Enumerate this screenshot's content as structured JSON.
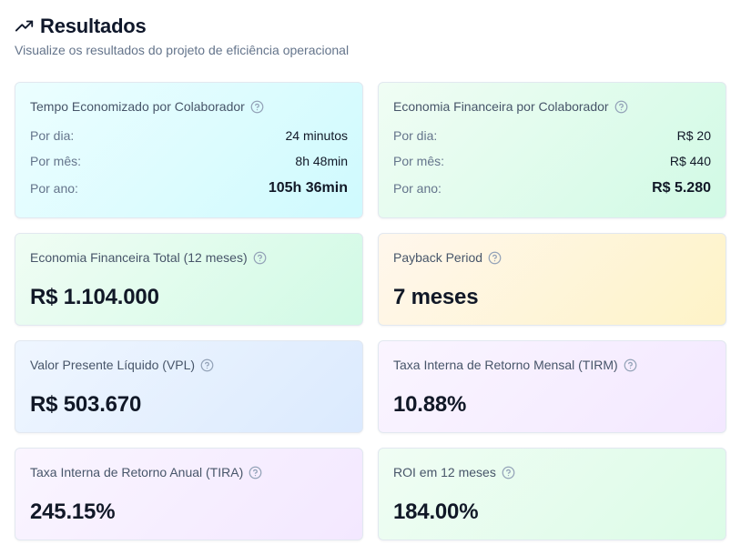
{
  "header": {
    "title": "Resultados",
    "subtitle": "Visualize os resultados do projeto de eficiência operacional",
    "icon": "trending-up-icon"
  },
  "time_card": {
    "title": "Tempo Economizado por Colaborador",
    "rows": [
      {
        "label": "Por dia:",
        "value": "24 minutos"
      },
      {
        "label": "Por mês:",
        "value": "8h 48min"
      },
      {
        "label": "Por ano:",
        "value": "105h 36min"
      }
    ]
  },
  "money_card": {
    "title": "Economia Financeira por Colaborador",
    "rows": [
      {
        "label": "Por dia:",
        "value": "R$ 20"
      },
      {
        "label": "Por mês:",
        "value": "R$ 440"
      },
      {
        "label": "Por ano:",
        "value": "R$ 5.280"
      }
    ]
  },
  "metrics": [
    {
      "title": "Economia Financeira Total (12 meses)",
      "value": "R$ 1.104.000"
    },
    {
      "title": "Payback Period",
      "value": "7 meses"
    },
    {
      "title": "Valor Presente Líquido (VPL)",
      "value": "R$ 503.670"
    },
    {
      "title": "Taxa Interna de Retorno Mensal (TIRM)",
      "value": "10.88%"
    },
    {
      "title": "Taxa Interna de Retorno Anual (TIRA)",
      "value": "245.15%"
    },
    {
      "title": "ROI em 12 meses",
      "value": "184.00%"
    }
  ],
  "colors": {
    "cyan": "#cffafe",
    "green": "#d1fae5",
    "amber": "#fef3c7",
    "blue": "#dbeafe",
    "purple": "#f3e8ff"
  }
}
